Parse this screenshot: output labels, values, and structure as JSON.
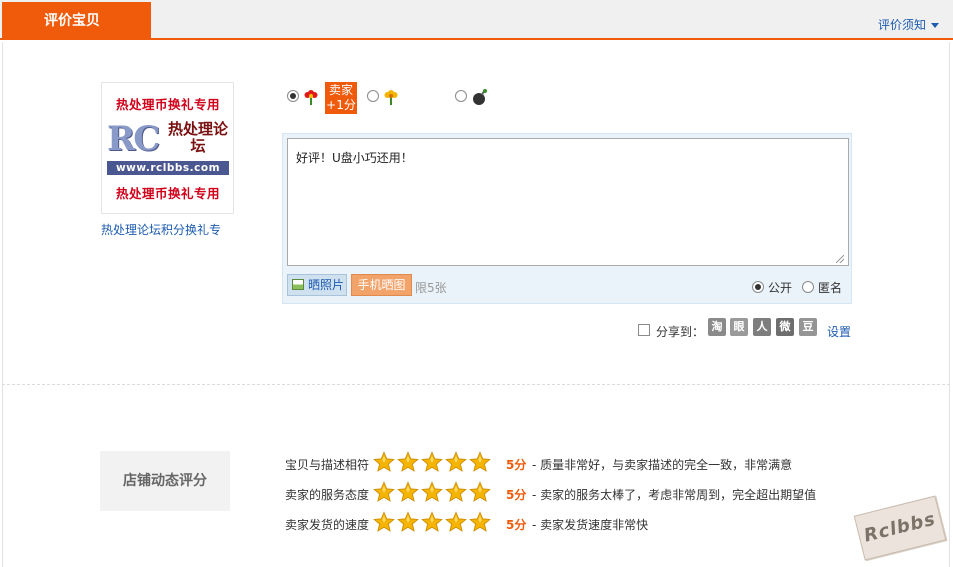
{
  "header": {
    "title": "评价宝贝",
    "notice_link": "评价须知"
  },
  "product": {
    "image_text_top": "热处理币换礼专用",
    "image_logo_letters": "RC",
    "image_logo_cn": "热处理论坛",
    "image_url": "www.rclbbs.com",
    "image_text_bottom": "热处理币换礼专用",
    "name": "热处理论坛积分换礼专"
  },
  "rating": {
    "options": [
      {
        "icon": "red-flower-icon",
        "selected": true,
        "badge_line1": "卖家",
        "badge_line2": "+1分"
      },
      {
        "icon": "yellow-flower-icon",
        "selected": false
      },
      {
        "icon": "bomb-icon",
        "selected": false
      }
    ]
  },
  "review": {
    "text": "好评！U盘小巧还用！",
    "photo_button": "晒照片",
    "mobile_button": "手机晒图",
    "limit": "限5张",
    "public_label": "公开",
    "anonymous_label": "匿名",
    "public_selected": true
  },
  "share": {
    "label": "分享到：",
    "checked": false,
    "icons": [
      "淘",
      "眼",
      "人",
      "微",
      "豆"
    ],
    "settings": "设置"
  },
  "shop_rating": {
    "title": "店铺动态评分",
    "star_color": "#f5b400",
    "rows": [
      {
        "label": "宝贝与描述相符",
        "stars": 5,
        "score": "5分",
        "desc": "- 质量非常好，与卖家描述的完全一致，非常满意"
      },
      {
        "label": "卖家的服务态度",
        "stars": 5,
        "score": "5分",
        "desc": "- 卖家的服务太棒了，考虑非常周到，完全超出期望值"
      },
      {
        "label": "卖家发货的速度",
        "stars": 5,
        "score": "5分",
        "desc": "- 卖家发货速度非常快"
      }
    ]
  },
  "watermark": "Rclbbs",
  "colors": {
    "accent": "#f05a0b",
    "link": "#1c5bb0"
  }
}
